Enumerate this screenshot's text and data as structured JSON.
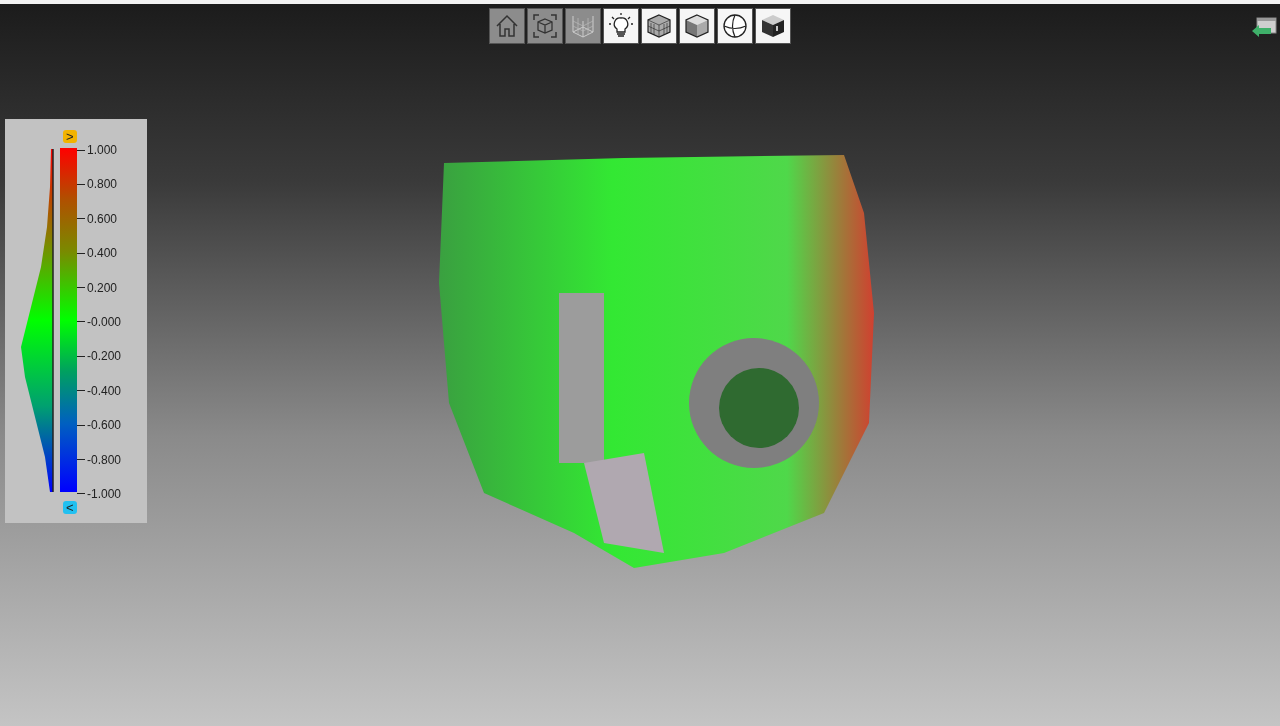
{
  "toolbar": {
    "buttons": [
      {
        "kind": "home",
        "active": true
      },
      {
        "kind": "fit",
        "active": true
      },
      {
        "kind": "grid",
        "active": true
      },
      {
        "kind": "light",
        "active": false
      },
      {
        "kind": "mesh",
        "active": false
      },
      {
        "kind": "shaded",
        "active": false
      },
      {
        "kind": "sphere",
        "active": false
      },
      {
        "kind": "dark",
        "active": false
      }
    ]
  },
  "legend": {
    "upper_marker": ">",
    "lower_marker": "<",
    "labels": [
      "1.000",
      "0.800",
      "0.600",
      "0.400",
      "0.200",
      "-0.000",
      "-0.200",
      "-0.400",
      "-0.600",
      "-0.800",
      "-1.000"
    ]
  }
}
